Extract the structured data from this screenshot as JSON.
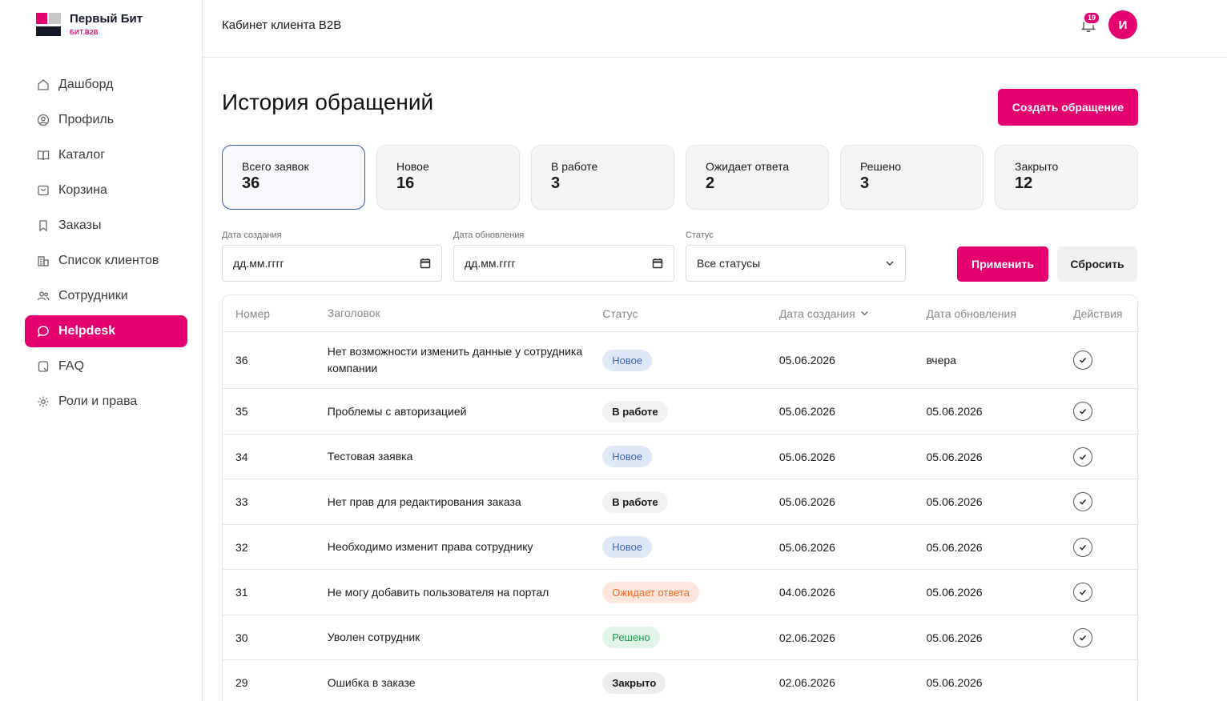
{
  "brand": {
    "name": "Первый Бит",
    "sub": "БИТ.B2B"
  },
  "header": {
    "title": "Кабинет клиента B2B",
    "notifications": "19",
    "avatar_letter": "И"
  },
  "sidebar": {
    "items": [
      {
        "label": "Дашборд",
        "icon": "home-icon"
      },
      {
        "label": "Профиль",
        "icon": "user-circle-icon"
      },
      {
        "label": "Каталог",
        "icon": "book-icon"
      },
      {
        "label": "Корзина",
        "icon": "cart-icon"
      },
      {
        "label": "Заказы",
        "icon": "bookmark-icon"
      },
      {
        "label": "Список клиентов",
        "icon": "building-icon"
      },
      {
        "label": "Сотрудники",
        "icon": "users-icon"
      },
      {
        "label": "Helpdesk",
        "icon": "chat-icon",
        "active": true
      },
      {
        "label": "FAQ",
        "icon": "faq-icon"
      },
      {
        "label": "Роли и права",
        "icon": "gear-icon"
      }
    ]
  },
  "main": {
    "title": "История обращений",
    "create_button": "Создать обращение",
    "stats": [
      {
        "label": "Всего заявок",
        "value": "36"
      },
      {
        "label": "Новое",
        "value": "16"
      },
      {
        "label": "В работе",
        "value": "3"
      },
      {
        "label": "Ожидает ответа",
        "value": "2"
      },
      {
        "label": "Решено",
        "value": "3"
      },
      {
        "label": "Закрыто",
        "value": "12"
      }
    ],
    "filters": {
      "created_label": "Дата создания",
      "created_placeholder": "дд.мм.гггг",
      "updated_label": "Дата обновления",
      "updated_placeholder": "дд.мм.гггг",
      "status_label": "Статус",
      "status_value": "Все статусы",
      "apply": "Применить",
      "reset": "Сбросить"
    },
    "table": {
      "columns": [
        "Номер",
        "Заголовок",
        "Статус",
        "Дата создания",
        "Дата обновления",
        "Действия"
      ],
      "rows": [
        {
          "num": "36",
          "title": "Нет возможности изменить данные у сотрудника компании",
          "status": "Новое",
          "status_kind": "new",
          "created": "05.06.2026",
          "updated": "вчера"
        },
        {
          "num": "35",
          "title": "Проблемы с авторизацией",
          "status": "В работе",
          "status_kind": "work",
          "created": "05.06.2026",
          "updated": "05.06.2026"
        },
        {
          "num": "34",
          "title": "Тестовая заявка",
          "status": "Новое",
          "status_kind": "new",
          "created": "05.06.2026",
          "updated": "05.06.2026"
        },
        {
          "num": "33",
          "title": "Нет прав для редактирования заказа",
          "status": "В работе",
          "status_kind": "work",
          "created": "05.06.2026",
          "updated": "05.06.2026"
        },
        {
          "num": "32",
          "title": "Необходимо изменит права сотруднику",
          "status": "Новое",
          "status_kind": "new",
          "created": "05.06.2026",
          "updated": "05.06.2026"
        },
        {
          "num": "31",
          "title": "Не могу добавить пользователя на портал",
          "status": "Ожидает ответа",
          "status_kind": "wait",
          "created": "04.06.2026",
          "updated": "05.06.2026"
        },
        {
          "num": "30",
          "title": "Уволен сотрудник",
          "status": "Решено",
          "status_kind": "done",
          "created": "02.06.2026",
          "updated": "05.06.2026"
        },
        {
          "num": "29",
          "title": "Ошибка в заказе",
          "status": "Закрыто",
          "status_kind": "closed",
          "created": "02.06.2026",
          "updated": "05.06.2026"
        }
      ]
    }
  },
  "colors": {
    "accent": "#e4006f",
    "navy": "#141a2a"
  }
}
